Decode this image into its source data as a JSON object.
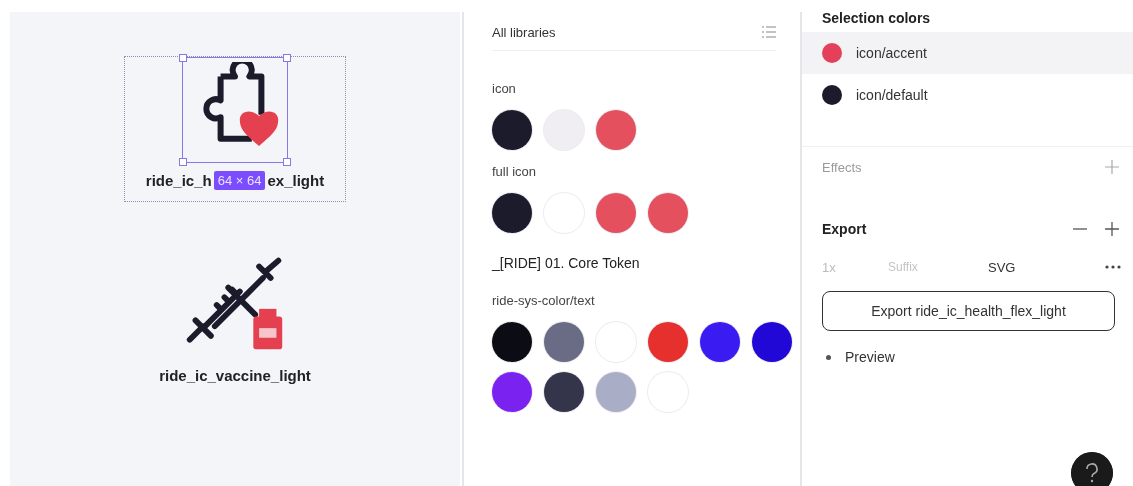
{
  "canvas": {
    "frames": [
      {
        "kind": "puzzle-heart",
        "selected": true,
        "name_parts": [
          "ride_ic_h",
          "ex_light"
        ],
        "size_badge": "64 × 64"
      },
      {
        "kind": "syringe-vial",
        "selected": false,
        "name_parts": [
          "ride_ic_vaccine_light"
        ]
      }
    ]
  },
  "libraries": {
    "title": "All libraries",
    "groups": [
      {
        "kind": "group",
        "label": "icon",
        "swatches": [
          {
            "color": "#1b1b2b"
          },
          {
            "color": "#f1eef3"
          },
          {
            "color": "#e4505e"
          }
        ]
      },
      {
        "kind": "group",
        "label": "full icon",
        "swatches": [
          {
            "color": "#1b1b2b"
          },
          {
            "color": "#ffffff"
          },
          {
            "color": "#e4505e"
          },
          {
            "color": "#e4505e"
          }
        ]
      },
      {
        "kind": "heading",
        "label": "_[RIDE] 01. Core Token"
      },
      {
        "kind": "group",
        "label": "ride-sys-color/text",
        "swatches": [
          {
            "color": "#0c0c14"
          },
          {
            "color": "#6a6c85"
          },
          {
            "color": "#ffffff"
          },
          {
            "color": "#e5302e"
          },
          {
            "color": "#3a1cf2"
          },
          {
            "color": "#2108d6"
          },
          {
            "color": "#7a22f0"
          },
          {
            "color": "#34354b"
          },
          {
            "color": "#a9adc6"
          },
          {
            "color": "#ffffff"
          }
        ]
      }
    ]
  },
  "properties": {
    "selection_colors": {
      "title": "Selection colors",
      "items": [
        {
          "label": "icon/accent",
          "color": "#e4405a",
          "selected": true
        },
        {
          "label": "icon/default",
          "color": "#1b1b2b",
          "selected": false
        }
      ]
    },
    "effects": {
      "title": "Effects"
    },
    "export": {
      "title": "Export",
      "scale": "1x",
      "suffix_placeholder": "Suffix",
      "format": "SVG",
      "button": "Export ride_ic_health_flex_light",
      "preview": "Preview"
    }
  }
}
